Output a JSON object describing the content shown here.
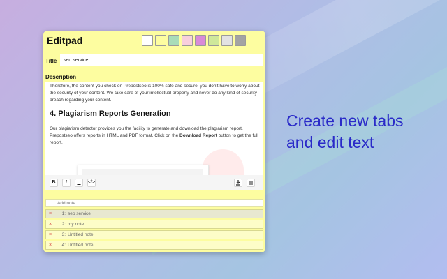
{
  "app": {
    "title": "Editpad"
  },
  "swatches": [
    {
      "color": "#ffffff"
    },
    {
      "color": "#fdfda0"
    },
    {
      "color": "#a8dcb8"
    },
    {
      "color": "#f8cfdc"
    },
    {
      "color": "#d98ad8"
    },
    {
      "color": "#cfe89a"
    },
    {
      "color": "#e2e2e2"
    },
    {
      "color": "#a3a3a3"
    }
  ],
  "title_field": {
    "label": "Title",
    "value": "seo service"
  },
  "description": {
    "label": "Description",
    "para1": "Therefore, the content you check on Prepostseo is 100% safe and secure. you don't have to worry about the security of your content. We take care of your intellectual property and never do any kind of security breach regarding your content.",
    "heading": "4. Plagiarism Reports Generation",
    "para2_start": "Our plagiarism detector provides you the facility to generate and download the plagiarism report. Prepostseo offers reports in HTML and PDF format. Click on the ",
    "para2_bold": "Download Report",
    "para2_end": " button to get the full report."
  },
  "toolbar": {
    "bold_label": "B",
    "italic_label": "I",
    "underline_label": "U",
    "code_label": "</>",
    "download_icon": "download-icon",
    "menu_icon": "menu-icon"
  },
  "notes": {
    "add_placeholder": "Add note",
    "items": [
      {
        "num": "1:",
        "title": "seo service"
      },
      {
        "num": "2:",
        "title": "my note"
      },
      {
        "num": "3:",
        "title": "Untitled note"
      },
      {
        "num": "4:",
        "title": "Untitled note"
      }
    ]
  },
  "tagline": "Create new tabs\nand edit text"
}
